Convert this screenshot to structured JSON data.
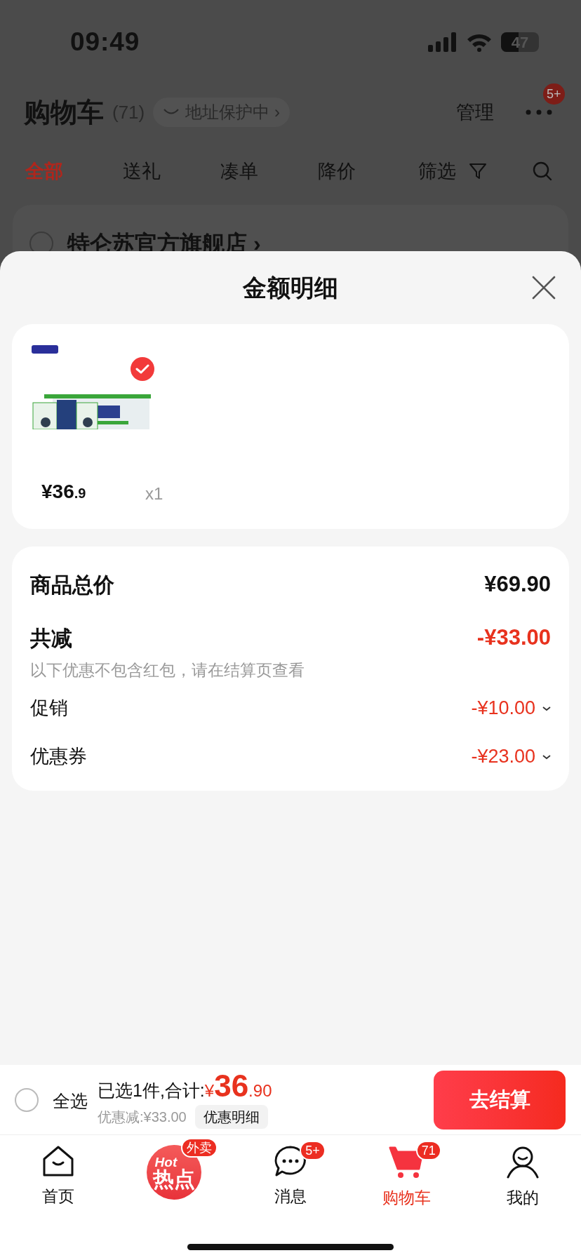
{
  "status_bar": {
    "time": "09:49",
    "battery": "47"
  },
  "header": {
    "title": "购物车",
    "count": "(71)",
    "address_badge": "地址保护中 ›",
    "manage": "管理",
    "more_badge": "5+"
  },
  "tabs": [
    {
      "label": "全部",
      "selected": true
    },
    {
      "label": "送礼",
      "selected": false
    },
    {
      "label": "凑单",
      "selected": false
    },
    {
      "label": "降价",
      "selected": false
    }
  ],
  "filter": "筛选",
  "store": {
    "name": "特仑苏官方旗舰店 ›",
    "checked": false
  },
  "sheet": {
    "title": "金额明细",
    "product": {
      "checked": true,
      "price_main": "¥36",
      "price_fraction": ".9",
      "quantity": "x1"
    },
    "summary": [
      {
        "kind": "total",
        "label": "商品总价",
        "amount": "¥69.90"
      },
      {
        "kind": "reduction",
        "label": "共减",
        "amount": "-¥33.00"
      },
      {
        "kind": "note",
        "label": "以下优惠不包含红包，请在结算页查看"
      },
      {
        "kind": "detail",
        "label": "促销",
        "amount": "-¥10.00"
      },
      {
        "kind": "detail",
        "label": "优惠券",
        "amount": "-¥23.00"
      }
    ]
  },
  "checkout_bar": {
    "select_all": {
      "label": "全选",
      "checked": false
    },
    "selected_text": "已选1件,合计:",
    "currency": "¥",
    "total_main": "36",
    "total_fraction": ".90",
    "discount": "优惠减:¥33.00",
    "discount_details": "优惠明细",
    "checkout_button": "去结算"
  },
  "nav": [
    {
      "kind": "home",
      "label": "首页",
      "selected": false
    },
    {
      "kind": "hot",
      "logo_top": "Hot",
      "logo_main": "热点",
      "badge": "外卖"
    },
    {
      "kind": "messages",
      "label": "消息",
      "badge": "5+",
      "selected": false
    },
    {
      "kind": "cart",
      "label": "购物车",
      "badge": "71",
      "selected": true
    },
    {
      "kind": "me",
      "label": "我的",
      "selected": false
    }
  ]
}
